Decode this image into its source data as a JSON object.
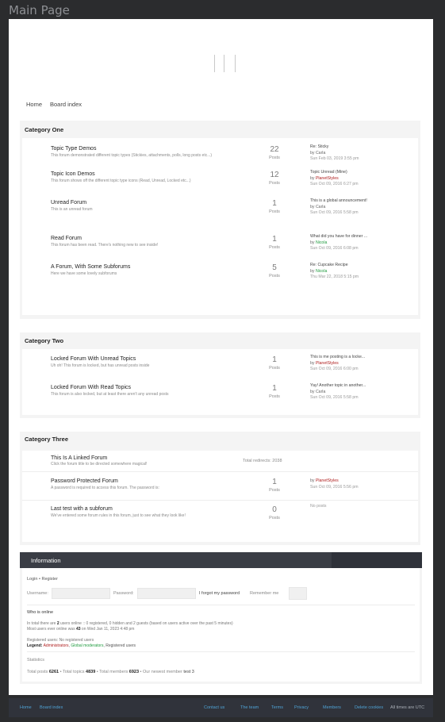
{
  "window": {
    "title": "Main Page"
  },
  "nav": {
    "home": "Home",
    "board_index": "Board index"
  },
  "colors": {
    "admin_color": "#b02020",
    "moderator_color": "#1f9b3e",
    "footer_link": "#4fa3d6"
  },
  "categories": [
    {
      "name": "Category One",
      "forums": [
        {
          "title": "Topic Type Demos",
          "desc": "This forum demonstrated different topic types (Stickies, attachments, polls, long posts etc...)",
          "count": "22",
          "count_label": "Posts",
          "last_post": {
            "title": "Re: Sticky",
            "by": "by",
            "user": "Carla",
            "date": "Sun Feb 03, 2019 3:55 pm"
          }
        },
        {
          "title": "Topic Icon Demos",
          "desc": "This forum shows off the different topic type icons (Read, Unread, Locked etc...)",
          "count": "12",
          "count_label": "Posts",
          "last_post": {
            "title": "Topic Unread (Mine)",
            "by": "by",
            "user": "PlanetStyles",
            "date": "Sun Oct 09, 2016 6:27 pm"
          }
        },
        {
          "title": "Unread Forum",
          "desc": "This is an unread forum",
          "count": "1",
          "count_label": "Posts",
          "last_post": {
            "title": "This is a global announcement!",
            "by": "by",
            "user": "Carla",
            "date": "Sun Oct 09, 2016 5:58 pm"
          }
        },
        {
          "title": "Read Forum",
          "desc": "This forum has been read. There's nothing new to see inside!",
          "count": "1",
          "count_label": "Posts",
          "last_post": {
            "title": "What did you have for dinner ...",
            "by": "by",
            "user": "Nicola",
            "date": "Sun Oct 09, 2016 6:08 pm"
          }
        },
        {
          "title": "A Forum, With Some Subforums",
          "desc": "Here we have some lovely subforums",
          "count": "5",
          "count_label": "Posts",
          "last_post": {
            "title": "Re: Cupcake Recipe",
            "by": "by",
            "user": "Nicola",
            "date": "Thu Mar 22, 2018 5:15 pm"
          }
        }
      ]
    },
    {
      "name": "Category Two",
      "forums": [
        {
          "title": "Locked Forum With Unread Topics",
          "desc": "Uh oh! This forum is locked, but has unread posts inside",
          "count": "1",
          "count_label": "Posts",
          "last_post": {
            "title": "This is me posting is a locke...",
            "by": "by",
            "user": "PlanetStyles",
            "date": "Sun Oct 09, 2016 6:00 pm"
          }
        },
        {
          "title": "Locked Forum With Read Topics",
          "desc": "This forum is also locked, but at least there aren't any unread posts",
          "count": "1",
          "count_label": "Posts",
          "last_post": {
            "title": "Yay! Another topic in another...",
            "by": "by",
            "user": "Carla",
            "date": "Sun Oct 09, 2016 5:58 pm"
          }
        }
      ]
    },
    {
      "name": "Category Three",
      "forums": [
        {
          "title": "This Is A Linked Forum",
          "desc": "Click the forum title to be directed somewhere magical!",
          "redirects": "Total redirects: 2038"
        },
        {
          "title": "Password Protected Forum",
          "desc": "A password is required to access this forum. The password is:",
          "count": "1",
          "count_label": "Posts",
          "last_post": {
            "title": "",
            "by": "by",
            "user": "PlanetStyles",
            "date": "Sun Oct 09, 2016 5:56 pm"
          }
        },
        {
          "title": "Last test with a subforum",
          "desc": "We've entered some forum rules in this forum, just to see what they look like!",
          "count": "0",
          "count_label": "Posts",
          "last_post": {
            "no_posts": "No posts"
          }
        }
      ]
    }
  ],
  "information": {
    "title": "Information",
    "login_link": "Login",
    "login_sep": "•",
    "register_link": "Register",
    "username_label": "Username:",
    "password_label": "Password:",
    "forgot": "I forgot my password",
    "remember": "Remember me",
    "who_online": "Who is online",
    "online_text_pre": "In total there are ",
    "online_count": "2",
    "online_text_post": " users online :: 0 registered, 0 hidden and 2 guests (based on users active over the past 5 minutes)",
    "most_pre": "Most users ever online was ",
    "most_count": "43",
    "most_post": " on Wed Jan 11, 2023 4:48 pm",
    "registered": "Registered users: No registered users",
    "legend_label": "Legend:",
    "legend_admin": "Administrators",
    "legend_mod": "Global moderators",
    "legend_reg": "Registered users",
    "stats_title": "Statistics",
    "stats_posts_label": "Total posts",
    "stats_posts": "6261",
    "stats_topics_label": "Total topics",
    "stats_topics": "4839",
    "stats_members_label": "Total members",
    "stats_members": "6923",
    "stats_newest_label": "Our newest member",
    "stats_newest": "test 3"
  },
  "footer": {
    "home": "Home",
    "board_index": "Board index",
    "contact": "Contact us",
    "team": "The team",
    "terms": "Terms",
    "privacy": "Privacy",
    "members": "Members",
    "delete_cookies": "Delete cookies",
    "timezone": "All times are UTC"
  }
}
